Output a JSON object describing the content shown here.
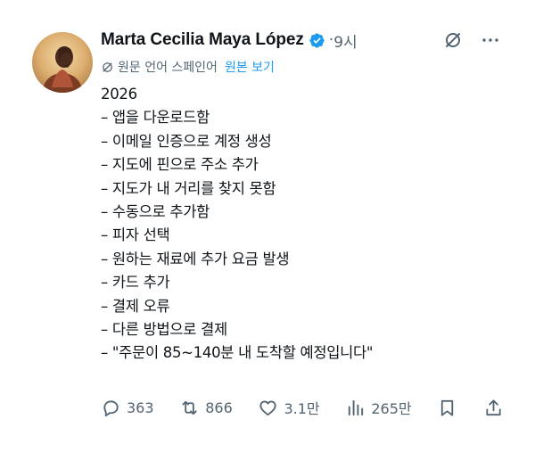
{
  "author": {
    "name": "Marta Cecilia Maya López",
    "verified_icon": "verified-badge-icon",
    "time_separator": "·",
    "time": "9시"
  },
  "header_icons": [
    "grok-icon",
    "more-icon"
  ],
  "translation": {
    "icon": "translate-icon",
    "text": "원문 언어 스페인어",
    "show_original": "원본 보기"
  },
  "body_lines": [
    "2026",
    "– 앱을 다운로드함",
    "– 이메일 인증으로 계정 생성",
    "– 지도에 핀으로 주소 추가",
    "– 지도가 내 거리를 찾지 못함",
    "– 수동으로 추가함",
    "– 피자 선택",
    "– 원하는 재료에 추가 요금 발생",
    "– 카드 추가",
    "– 결제 오류",
    "– 다른 방법으로 결제",
    "– \"주문이 85~140분 내 도착할 예정입니다\""
  ],
  "actions": {
    "replies": "363",
    "reposts": "866",
    "likes": "3.1만",
    "views": "265만"
  },
  "colors": {
    "text": "#0f1419",
    "muted": "#536471",
    "link": "#1d9bf0",
    "verified": "#1d9bf0"
  }
}
